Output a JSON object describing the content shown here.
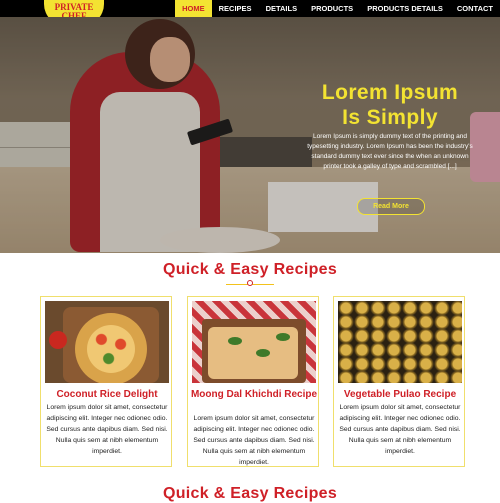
{
  "header": {
    "logo": {
      "line1": "PRIVATE",
      "line2": "CHEF"
    },
    "nav": [
      {
        "label": "HOME",
        "active": true
      },
      {
        "label": "RECIPES",
        "active": false
      },
      {
        "label": "DETAILS",
        "active": false
      },
      {
        "label": "PRODUCTS",
        "active": false
      },
      {
        "label": "PRODUCTS DETAILS",
        "active": false
      },
      {
        "label": "CONTACT",
        "active": false
      }
    ]
  },
  "hero": {
    "title_line1": "Lorem Ipsum",
    "title_line2": "Is Simply",
    "text": "Lorem Ipsum is simply dummy text of the printing and typesetting industry. Lorem Ipsum has been the industry's standard dummy text ever since the when an unknown printer took a galley of type and scrambled [...]",
    "button": "Read More"
  },
  "section": {
    "title": "Quick & Easy Recipes",
    "cards": [
      {
        "name": "Coconut Rice Delight",
        "desc": "Lorem ipsum dolor sit amet, consectetur adipiscing elit. Integer nec odionec odio. Sed cursus ante dapibus diam. Sed nisi. Nulla quis sem at nibh elementum imperdiet."
      },
      {
        "name": "Moong Dal Khichdi Recipe",
        "desc": "Lorem ipsum dolor sit amet, consectetur adipiscing elit. Integer nec odionec odio. Sed cursus ante dapibus diam. Sed nisi. Nulla quis sem at nibh elementum imperdiet."
      },
      {
        "name": "Vegetable Pulao Recipe",
        "desc": "Lorem ipsum dolor sit amet, consectetur adipiscing elit. Integer nec odionec odio. Sed cursus ante dapibus diam. Sed nisi. Nulla quis sem at nibh elementum imperdiet."
      }
    ]
  },
  "section2": {
    "title": "Quick & Easy Recipes"
  },
  "colors": {
    "accent_yellow": "#f3e332",
    "accent_red": "#cf2027",
    "header_bg": "#000000"
  }
}
